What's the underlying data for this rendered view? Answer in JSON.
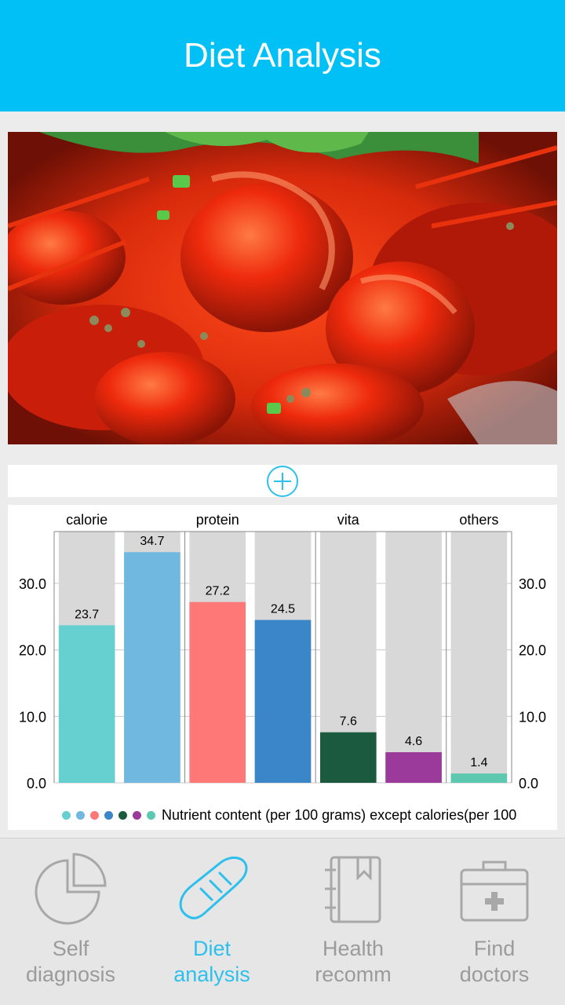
{
  "header": {
    "title": "Diet Analysis"
  },
  "photo": {
    "subject": "crayfish dish",
    "icon": "food-photo"
  },
  "add_button": {
    "icon": "plus-circle-icon"
  },
  "chart_data": {
    "type": "bar",
    "categories": [
      "calorie",
      "protein",
      "vita",
      "others"
    ],
    "values": [
      23.7,
      34.7,
      27.2,
      24.5,
      7.6,
      4.6,
      1.4
    ],
    "value_labels": [
      "23.7",
      "34.7",
      "27.2",
      "24.5",
      "7.6",
      "4.6",
      "1.4"
    ],
    "colors": [
      "#66d0d0",
      "#70b8e0",
      "#ff7878",
      "#3a86c8",
      "#1c5a40",
      "#9b3a9b",
      "#5cc8b0"
    ],
    "background_bar_color": "#d8d8d8",
    "ylim": [
      0,
      37.8
    ],
    "yticks": [
      0,
      10,
      20,
      30
    ],
    "ytick_labels": [
      "0.0",
      "10.0",
      "20.0",
      "30.0"
    ],
    "grid": true,
    "legend_text": "Nutrient content (per 100 grams) except calories(per 100",
    "legend_placement": "bottom"
  },
  "tabs": [
    {
      "label": "Self\ndiagnosis",
      "icon": "pie-chart-icon",
      "active": false
    },
    {
      "label": "Diet\nanalysis",
      "icon": "bread-icon",
      "active": true
    },
    {
      "label": "Health\nrecomm",
      "icon": "notebook-icon",
      "active": false
    },
    {
      "label": "Find\ndoctors",
      "icon": "medical-kit-icon",
      "active": false
    }
  ]
}
